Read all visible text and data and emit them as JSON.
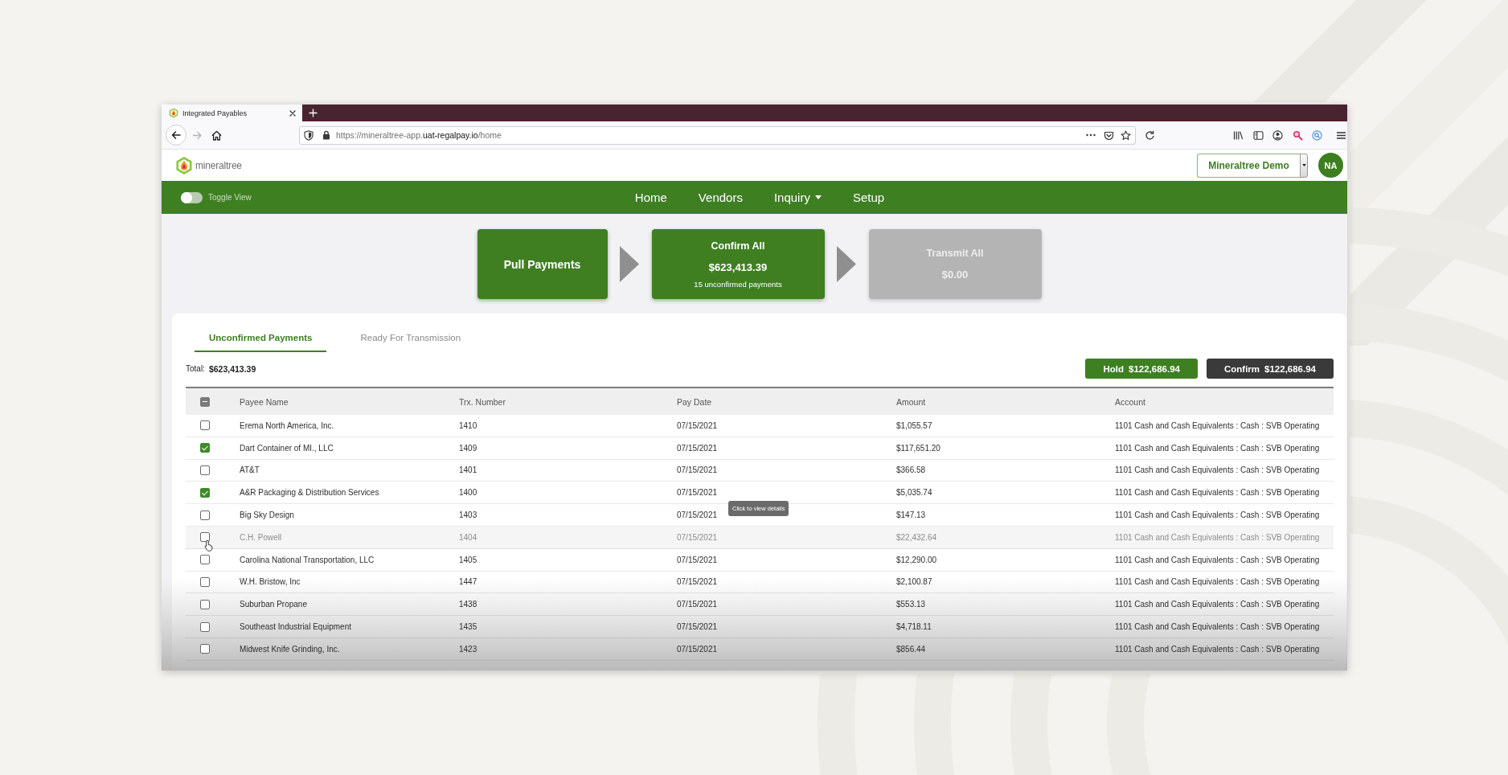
{
  "browser": {
    "tabs": [
      {
        "title": "Integrated Payables",
        "selected": true
      }
    ],
    "forward": {
      "disabled": true
    },
    "url": "https://mineraltree-app.**uat-regalpay.io**/home"
  },
  "header": {
    "logo": "mineraltree",
    "account": "Mineraltree Demo",
    "avatar": "NA"
  },
  "nav": {
    "toggle": {
      "label": "Toggle View",
      "on": false
    },
    "items": [
      {
        "label": "Home",
        "kind": "link"
      },
      {
        "label": "Vendors",
        "kind": "link"
      },
      {
        "label": "Inquiry",
        "kind": "menu"
      },
      {
        "label": "Setup",
        "kind": "link"
      }
    ]
  },
  "steps": [
    {
      "title": "Pull Payments",
      "disabled": false
    },
    {
      "title": "Confirm All",
      "amount": "$623,413.39",
      "note": "15 unconfirmed payments",
      "disabled": false
    },
    {
      "title": "Transmit All",
      "amount": "$0.00",
      "disabled": true
    }
  ],
  "panel": {
    "tabs": [
      {
        "label": "Unconfirmed Payments",
        "selected": true
      },
      {
        "label": "Ready For Transmission",
        "selected": false
      }
    ],
    "total": {
      "label": "Total:",
      "value": "$623,413.39"
    },
    "actions": [
      {
        "label": "Hold",
        "amount": "$122,686.94",
        "kind": "hold"
      },
      {
        "label": "Confirm",
        "amount": "$122,686.94",
        "kind": "confirm"
      }
    ],
    "table": {
      "select_all": {
        "indeterminate": true
      },
      "columns": [
        "Payee Name",
        "Trx. Number",
        "Pay Date",
        "Amount",
        "Account"
      ],
      "rows": [
        {
          "payee": "Erema North America, Inc.",
          "trx": "1410",
          "date": "07/15/2021",
          "amount": "$1,055.57",
          "account": "1101 Cash and Cash Equivalents : Cash : SVB Operating",
          "checked": false,
          "hovered": false
        },
        {
          "payee": "Dart Container of MI., LLC",
          "trx": "1409",
          "date": "07/15/2021",
          "amount": "$117,651.20",
          "account": "1101 Cash and Cash Equivalents : Cash : SVB Operating",
          "checked": true,
          "hovered": false
        },
        {
          "payee": "AT&T",
          "trx": "1401",
          "date": "07/15/2021",
          "amount": "$366.58",
          "account": "1101 Cash and Cash Equivalents : Cash : SVB Operating",
          "checked": false,
          "hovered": false
        },
        {
          "payee": "A&R Packaging & Distribution Services",
          "trx": "1400",
          "date": "07/15/2021",
          "amount": "$5,035.74",
          "account": "1101 Cash and Cash Equivalents : Cash : SVB Operating",
          "checked": true,
          "hovered": false
        },
        {
          "payee": "Big Sky Design",
          "trx": "1403",
          "date": "07/15/2021",
          "amount": "$147.13",
          "account": "1101 Cash and Cash Equivalents : Cash : SVB Operating",
          "checked": false,
          "hovered": false
        },
        {
          "payee": "C.H. Powell",
          "trx": "1404",
          "date": "07/15/2021",
          "amount": "$22,432.64",
          "account": "1101 Cash and Cash Equivalents : Cash : SVB Operating",
          "checked": false,
          "hovered": true
        },
        {
          "payee": "Carolina National Transportation, LLC",
          "trx": "1405",
          "date": "07/15/2021",
          "amount": "$12,290.00",
          "account": "1101 Cash and Cash Equivalents : Cash : SVB Operating",
          "checked": false,
          "hovered": false
        },
        {
          "payee": "W.H. Bristow, Inc",
          "trx": "1447",
          "date": "07/15/2021",
          "amount": "$2,100.87",
          "account": "1101 Cash and Cash Equivalents : Cash : SVB Operating",
          "checked": false,
          "hovered": false
        },
        {
          "payee": "Suburban Propane",
          "trx": "1438",
          "date": "07/15/2021",
          "amount": "$553.13",
          "account": "1101 Cash and Cash Equivalents : Cash : SVB Operating",
          "checked": false,
          "hovered": false
        },
        {
          "payee": "Southeast Industrial Equipment",
          "trx": "1435",
          "date": "07/15/2021",
          "amount": "$4,718.11",
          "account": "1101 Cash and Cash Equivalents : Cash : SVB Operating",
          "checked": false,
          "hovered": false
        },
        {
          "payee": "Midwest Knife Grinding, Inc.",
          "trx": "1423",
          "date": "07/15/2021",
          "amount": "$856.44",
          "account": "1101 Cash and Cash Equivalents : Cash : SVB Operating",
          "checked": false,
          "hovered": false
        }
      ],
      "tooltip": "Click to view details"
    }
  }
}
